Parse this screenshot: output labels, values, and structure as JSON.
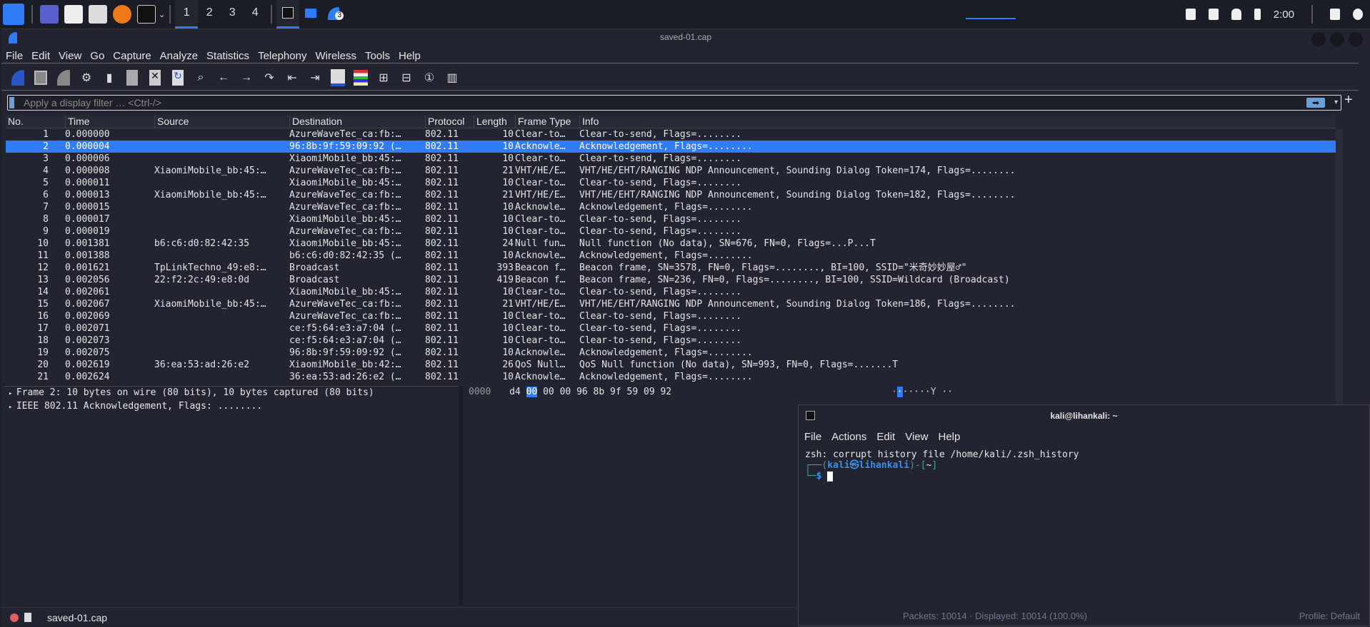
{
  "taskbar": {
    "workspaces": [
      "1",
      "2",
      "3",
      "4"
    ],
    "active_workspace": "1",
    "clock": "2:00",
    "badge": "3"
  },
  "window": {
    "title": "saved-01.cap"
  },
  "menu": [
    "File",
    "Edit",
    "View",
    "Go",
    "Capture",
    "Analyze",
    "Statistics",
    "Telephony",
    "Wireless",
    "Tools",
    "Help"
  ],
  "toolbar": [
    "shark-fin-start-icon",
    "stop-icon",
    "restart-icon",
    "options-gear-icon",
    "open-icon",
    "file-icon",
    "close-file-icon",
    "reload-icon",
    "search-icon",
    "back-arrow-icon",
    "forward-arrow-icon",
    "goto-packet-icon",
    "first-packet-icon",
    "last-packet-icon",
    "autoscroll-icon",
    "colorize-icon",
    "zoom-in-icon",
    "zoom-out-icon",
    "normal-size-icon",
    "resize-columns-icon"
  ],
  "filter": {
    "placeholder": "Apply a display filter … <Ctrl-/>"
  },
  "columns": [
    "No.",
    "Time",
    "Source",
    "Destination",
    "Protocol",
    "Length",
    "Frame Type",
    "Info"
  ],
  "selected_row": 2,
  "packets": [
    [
      "1",
      "0.000000",
      "",
      "AzureWaveTec_ca:fb:…",
      "802.11",
      "10",
      "Clear-to…",
      "Clear-to-send, Flags=........"
    ],
    [
      "2",
      "0.000004",
      "",
      "96:8b:9f:59:09:92 (…",
      "802.11",
      "10",
      "Acknowle…",
      "Acknowledgement, Flags=........"
    ],
    [
      "3",
      "0.000006",
      "",
      "XiaomiMobile_bb:45:…",
      "802.11",
      "10",
      "Clear-to…",
      "Clear-to-send, Flags=........"
    ],
    [
      "4",
      "0.000008",
      "XiaomiMobile_bb:45:…",
      "AzureWaveTec_ca:fb:…",
      "802.11",
      "21",
      "VHT/HE/E…",
      "VHT/HE/EHT/RANGING NDP Announcement, Sounding Dialog Token=174, Flags=........"
    ],
    [
      "5",
      "0.000011",
      "",
      "XiaomiMobile_bb:45:…",
      "802.11",
      "10",
      "Clear-to…",
      "Clear-to-send, Flags=........"
    ],
    [
      "6",
      "0.000013",
      "XiaomiMobile_bb:45:…",
      "AzureWaveTec_ca:fb:…",
      "802.11",
      "21",
      "VHT/HE/E…",
      "VHT/HE/EHT/RANGING NDP Announcement, Sounding Dialog Token=182, Flags=........"
    ],
    [
      "7",
      "0.000015",
      "",
      "AzureWaveTec_ca:fb:…",
      "802.11",
      "10",
      "Acknowle…",
      "Acknowledgement, Flags=........"
    ],
    [
      "8",
      "0.000017",
      "",
      "XiaomiMobile_bb:45:…",
      "802.11",
      "10",
      "Clear-to…",
      "Clear-to-send, Flags=........"
    ],
    [
      "9",
      "0.000019",
      "",
      "AzureWaveTec_ca:fb:…",
      "802.11",
      "10",
      "Clear-to…",
      "Clear-to-send, Flags=........"
    ],
    [
      "10",
      "0.001381",
      "b6:c6:d0:82:42:35",
      "XiaomiMobile_bb:45:…",
      "802.11",
      "24",
      "Null fun…",
      "Null function (No data), SN=676, FN=0, Flags=...P...T"
    ],
    [
      "11",
      "0.001388",
      "",
      "b6:c6:d0:82:42:35 (…",
      "802.11",
      "10",
      "Acknowle…",
      "Acknowledgement, Flags=........"
    ],
    [
      "12",
      "0.001621",
      "TpLinkTechno_49:e8:…",
      "Broadcast",
      "802.11",
      "393",
      "Beacon f…",
      "Beacon frame, SN=3578, FN=0, Flags=........, BI=100, SSID=\"米奇妙妙屋♂\""
    ],
    [
      "13",
      "0.002056",
      "22:f2:2c:49:e8:0d",
      "Broadcast",
      "802.11",
      "419",
      "Beacon f…",
      "Beacon frame, SN=236, FN=0, Flags=........, BI=100, SSID=Wildcard (Broadcast)"
    ],
    [
      "14",
      "0.002061",
      "",
      "XiaomiMobile_bb:45:…",
      "802.11",
      "10",
      "Clear-to…",
      "Clear-to-send, Flags=........"
    ],
    [
      "15",
      "0.002067",
      "XiaomiMobile_bb:45:…",
      "AzureWaveTec_ca:fb:…",
      "802.11",
      "21",
      "VHT/HE/E…",
      "VHT/HE/EHT/RANGING NDP Announcement, Sounding Dialog Token=186, Flags=........"
    ],
    [
      "16",
      "0.002069",
      "",
      "AzureWaveTec_ca:fb:…",
      "802.11",
      "10",
      "Clear-to…",
      "Clear-to-send, Flags=........"
    ],
    [
      "17",
      "0.002071",
      "",
      "ce:f5:64:e3:a7:04 (…",
      "802.11",
      "10",
      "Clear-to…",
      "Clear-to-send, Flags=........"
    ],
    [
      "18",
      "0.002073",
      "",
      "ce:f5:64:e3:a7:04 (…",
      "802.11",
      "10",
      "Clear-to…",
      "Clear-to-send, Flags=........"
    ],
    [
      "19",
      "0.002075",
      "",
      "96:8b:9f:59:09:92 (…",
      "802.11",
      "10",
      "Acknowle…",
      "Acknowledgement, Flags=........"
    ],
    [
      "20",
      "0.002619",
      "36:ea:53:ad:26:e2",
      "XiaomiMobile_bb:42:…",
      "802.11",
      "26",
      "QoS Null…",
      "QoS Null function (No data), SN=993, FN=0, Flags=.......T"
    ],
    [
      "21",
      "0.002624",
      "",
      "36:ea:53:ad:26:e2 (…",
      "802.11",
      "10",
      "Acknowle…",
      "Acknowledgement, Flags=........"
    ]
  ],
  "details": [
    "Frame 2: 10 bytes on wire (80 bits), 10 bytes captured (80 bits)",
    "IEEE 802.11 Acknowledgement, Flags: ........"
  ],
  "bytes": {
    "offset": "0000",
    "first": "d4",
    "highlight": "00",
    "rest": "00 00 96 8b 9f 59  09 92",
    "ascii": "·",
    "ascii_hl": "·",
    "ascii_rest": "·····Y ··"
  },
  "statusbar": {
    "file": "saved-01.cap",
    "packets": "Packets: 10014 · Displayed: 10014 (100.0%)",
    "profile": "Profile: Default"
  },
  "terminal": {
    "title": "kali@lihankali: ~",
    "menu": [
      "File",
      "Actions",
      "Edit",
      "View",
      "Help"
    ],
    "line1": "zsh: corrupt history file /home/kali/.zsh_history",
    "prompt_pre": "┌──(",
    "user": "kali㉿lihankali",
    "prompt_mid": ")-[",
    "cwd": "~",
    "prompt_end": "]",
    "prompt2": "└─",
    "dollar": "$"
  },
  "colors": {
    "selection": "#2f7cf6",
    "background": "#222531"
  }
}
